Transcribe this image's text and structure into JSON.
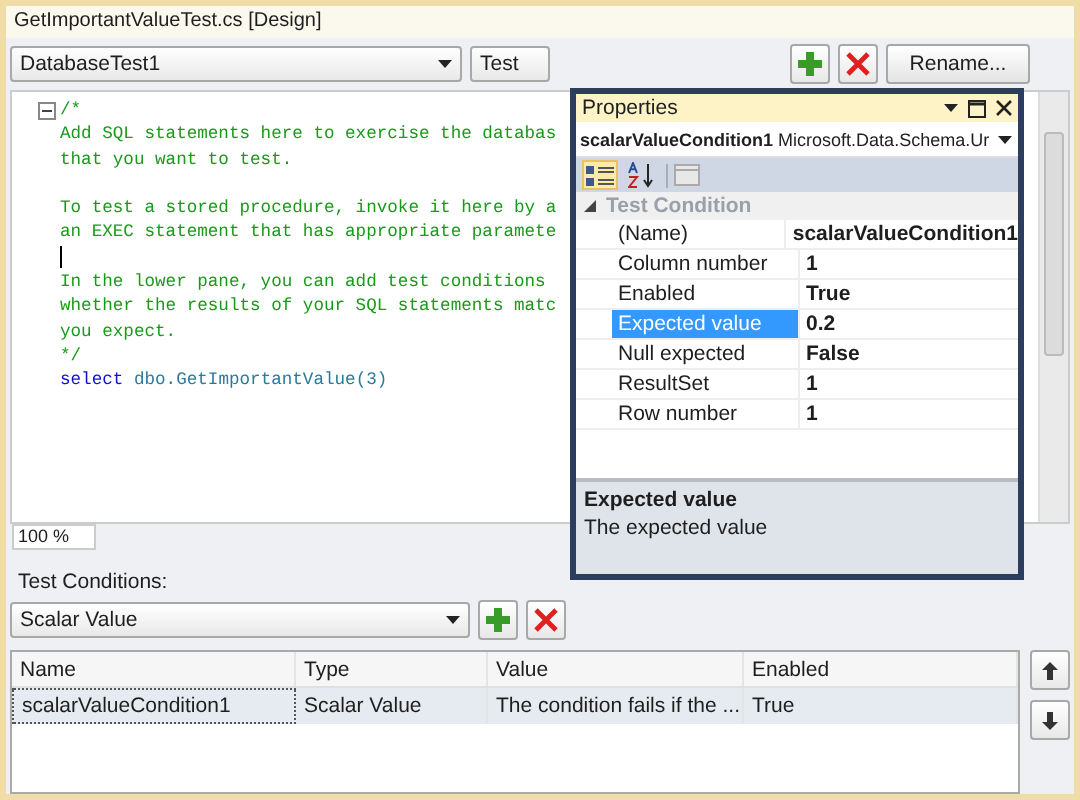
{
  "window": {
    "title": "GetImportantValueTest.cs [Design]"
  },
  "toolbar": {
    "test_dropdown": "DatabaseTest1",
    "type_dropdown": "Test",
    "rename_button": "Rename..."
  },
  "editor": {
    "zoom": "100 %",
    "lines": [
      {
        "kind": "comment",
        "text": "/*"
      },
      {
        "kind": "comment",
        "text": "Add SQL statements here to exercise the databas"
      },
      {
        "kind": "comment",
        "text": "that you want to test."
      },
      {
        "kind": "blank"
      },
      {
        "kind": "comment",
        "text": "To test a stored procedure, invoke it here by a"
      },
      {
        "kind": "comment",
        "text": "an EXEC statement that has appropriate paramete"
      },
      {
        "kind": "cursor"
      },
      {
        "kind": "comment",
        "text": "In the lower pane, you can add test conditions"
      },
      {
        "kind": "comment",
        "text": "whether the results of your SQL statements matc"
      },
      {
        "kind": "comment",
        "text": "you expect."
      },
      {
        "kind": "comment",
        "text": "*/"
      },
      {
        "kind": "code",
        "keyword": "select",
        "text": "dbo.GetImportantValue(3)"
      }
    ]
  },
  "test_conditions": {
    "label": "Test Conditions:",
    "type_dropdown": "Scalar Value",
    "columns": [
      "Name",
      "Type",
      "Value",
      "Enabled"
    ],
    "rows": [
      {
        "cells": [
          "scalarValueCondition1",
          "Scalar Value",
          "The condition fails if the ...",
          "True"
        ],
        "selected": true
      }
    ]
  },
  "properties": {
    "title": "Properties",
    "object_name": "scalarValueCondition1",
    "object_type": "Microsoft.Data.Schema.Ur",
    "views": [
      {
        "kind": "categorized",
        "selected": true
      },
      {
        "kind": "alphabetical",
        "selected": false
      }
    ],
    "category": {
      "label": "Test Condition",
      "expanded": true
    },
    "rows": [
      {
        "name": "(Name)",
        "value": "scalarValueCondition1",
        "selected": false
      },
      {
        "name": "Column number",
        "value": "1",
        "selected": false
      },
      {
        "name": "Enabled",
        "value": "True",
        "selected": false
      },
      {
        "name": "Expected value",
        "value": "0.2",
        "selected": true
      },
      {
        "name": "Null expected",
        "value": "False",
        "selected": false
      },
      {
        "name": "ResultSet",
        "value": "1",
        "selected": false
      },
      {
        "name": "Row number",
        "value": "1",
        "selected": false
      }
    ],
    "description": {
      "title": "Expected value",
      "text": "The expected value"
    }
  }
}
